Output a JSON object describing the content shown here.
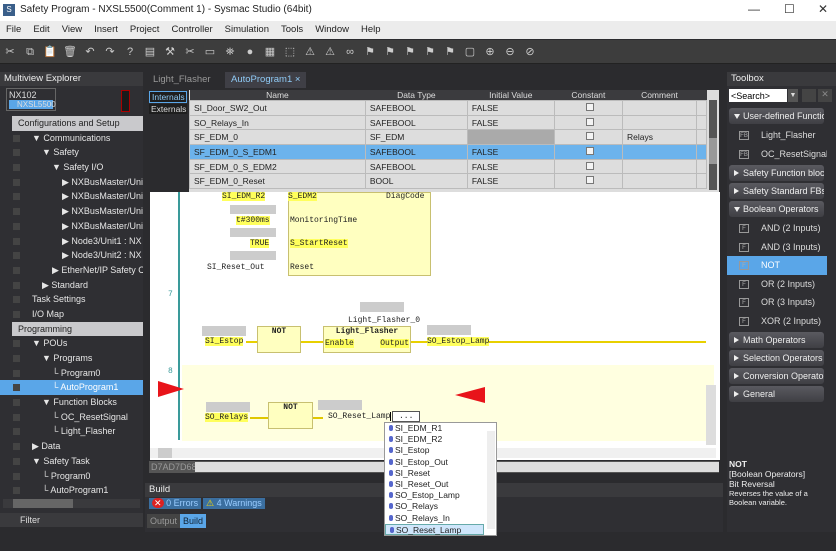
{
  "window": {
    "title": "Safety Program - NXSL5500(Comment 1) - Sysmac Studio (64bit)",
    "minimize": "—",
    "maximize": "☐",
    "close": "✕"
  },
  "menu": [
    "File",
    "Edit",
    "View",
    "Insert",
    "Project",
    "Controller",
    "Simulation",
    "Tools",
    "Window",
    "Help"
  ],
  "toolbar_icons": [
    "✂",
    "⧉",
    "📋",
    "🗑",
    "↶",
    "↷",
    "?",
    "▤",
    "⚒",
    "✂",
    "▭",
    "⛯",
    "●",
    "▦",
    "⬚",
    "⚠",
    "⚠",
    "∞",
    "⚑",
    "⚑",
    "⚑",
    "⚑",
    "⚑",
    "▢",
    "⊕",
    "⊖",
    "⊘"
  ],
  "explorer": {
    "title": "Multiview Explorer",
    "device": "NX102",
    "subdevice": "NXSL5500",
    "items": [
      {
        "label": "Configurations and Setup",
        "lvl": 0,
        "type": "section"
      },
      {
        "label": "▼ Communications",
        "lvl": 1
      },
      {
        "label": "▼ Safety",
        "lvl": 2
      },
      {
        "label": "▼ Safety I/O",
        "lvl": 3
      },
      {
        "label": "▶ NXBusMaster/Unit",
        "lvl": 4
      },
      {
        "label": "▶ NXBusMaster/Unit",
        "lvl": 4
      },
      {
        "label": "▶ NXBusMaster/Unit",
        "lvl": 4
      },
      {
        "label": "▶ NXBusMaster/Unit",
        "lvl": 4
      },
      {
        "label": "▶ Node3/Unit1 : NX",
        "lvl": 4
      },
      {
        "label": "▶ Node3/Unit2 : NX",
        "lvl": 4
      },
      {
        "label": "▶ EtherNet/IP Safety Conn",
        "lvl": 3
      },
      {
        "label": "▶ Standard",
        "lvl": 2
      },
      {
        "label": "Task Settings",
        "lvl": 1
      },
      {
        "label": "I/O Map",
        "lvl": 1
      },
      {
        "label": "Programming",
        "lvl": 0,
        "type": "section"
      },
      {
        "label": "▼ POUs",
        "lvl": 1
      },
      {
        "label": "▼ Programs",
        "lvl": 2
      },
      {
        "label": "└ Program0",
        "lvl": 3
      },
      {
        "label": "└ AutoProgram1",
        "lvl": 3,
        "type": "sel"
      },
      {
        "label": "▼ Function Blocks",
        "lvl": 2
      },
      {
        "label": "└ OC_ResetSignal",
        "lvl": 3
      },
      {
        "label": "└ Light_Flasher",
        "lvl": 3
      },
      {
        "label": "▶ Data",
        "lvl": 1
      },
      {
        "label": "▼ Safety Task",
        "lvl": 1
      },
      {
        "label": "└ Program0",
        "lvl": 2
      },
      {
        "label": "└ AutoProgram1",
        "lvl": 2
      }
    ],
    "filter": "Filter"
  },
  "tabs": [
    {
      "label": "Light_Flasher"
    },
    {
      "label": "AutoProgram1",
      "close": "×"
    }
  ],
  "vars": {
    "side_tabs": [
      "Internals",
      "Externals"
    ],
    "headers": [
      "Name",
      "Data Type",
      "Initial Value",
      "Constant",
      "Comment"
    ],
    "rows": [
      [
        "SI_Door_SW2_Out",
        "SAFEBOOL",
        "FALSE",
        ""
      ],
      [
        "SO_Relays_In",
        "SAFEBOOL",
        "FALSE",
        ""
      ],
      [
        "SF_EDM_0",
        "SF_EDM",
        "",
        "Relays"
      ],
      [
        "SF_EDM_0_S_EDM1",
        "SAFEBOOL",
        "FALSE",
        ""
      ],
      [
        "SF_EDM_0_S_EDM2",
        "SAFEBOOL",
        "FALSE",
        ""
      ],
      [
        "SF_EDM_0_Reset",
        "BOOL",
        "FALSE",
        ""
      ]
    ],
    "selected_row": 3
  },
  "diagram": {
    "top": {
      "in_edm": "SI_EDM_R2",
      "pin_edm": "S_EDM2",
      "diag": "DiagCode",
      "time_val": "t#300ms",
      "time_pin": "MonitoringTime",
      "true_val": "TRUE",
      "start_pin": "S_StartReset",
      "reset_val": "SI_Reset_Out",
      "reset_pin": "Reset"
    },
    "rung7": {
      "num": "7",
      "input": "SI_Estop",
      "not": "NOT",
      "instance": "Light_Flasher_0",
      "fb": "Light_Flasher",
      "enable": "Enable",
      "output": "Output",
      "out_var": "SO_Estop_Lamp"
    },
    "rung8": {
      "num": "8",
      "input": "SO_Relays",
      "not": "NOT",
      "out_var": "SO_Reset_Lamp",
      "browse": "..."
    }
  },
  "autocomplete": [
    "SI_EDM_R1",
    "SI_EDM_R2",
    "SI_Estop",
    "SI_Estop_Out",
    "SI_Reset",
    "SI_Reset_Out",
    "SO_Estop_Lamp",
    "SO_Relays",
    "SO_Relays_In",
    "SO_Reset_Lamp"
  ],
  "status_code": "D7AD7D68",
  "build": {
    "title": "Build",
    "errors": "0  Errors",
    "warnings": "4  Warnings",
    "tabs": [
      "Output",
      "Build"
    ]
  },
  "toolbox": {
    "title": "Toolbox",
    "search": "<Search>",
    "entries": [
      {
        "kind": "grp",
        "label": "User-defined Functio",
        "open": true
      },
      {
        "kind": "item",
        "label": "Light_Flasher",
        "icon": "FB"
      },
      {
        "kind": "item",
        "label": "OC_ResetSignal",
        "icon": "FB"
      },
      {
        "kind": "grp",
        "label": "Safety Function block"
      },
      {
        "kind": "grp",
        "label": "Safety Standard FBs"
      },
      {
        "kind": "grp",
        "label": "Boolean Operators",
        "open": true
      },
      {
        "kind": "item",
        "label": "AND (2 Inputs)",
        "icon": "F"
      },
      {
        "kind": "item",
        "label": "AND (3 Inputs)",
        "icon": "F"
      },
      {
        "kind": "item",
        "label": "NOT",
        "icon": "F",
        "sel": true
      },
      {
        "kind": "item",
        "label": "OR (2 Inputs)",
        "icon": "F"
      },
      {
        "kind": "item",
        "label": "OR (3 Inputs)",
        "icon": "F"
      },
      {
        "kind": "item",
        "label": "XOR (2 Inputs)",
        "icon": "F"
      },
      {
        "kind": "grp",
        "label": "Math Operators"
      },
      {
        "kind": "grp",
        "label": "Selection Operators"
      },
      {
        "kind": "grp",
        "label": "Conversion Operator"
      },
      {
        "kind": "grp",
        "label": "General"
      }
    ],
    "desc": {
      "name": "NOT",
      "cat": "[Boolean Operators]",
      "short": "Bit Reversal",
      "long": "Reverses the value of a Boolean variable."
    }
  },
  "colors": {
    "accent": "#5aa6e8",
    "highlight": "#ffff5c",
    "arrow": "#e8141a"
  }
}
